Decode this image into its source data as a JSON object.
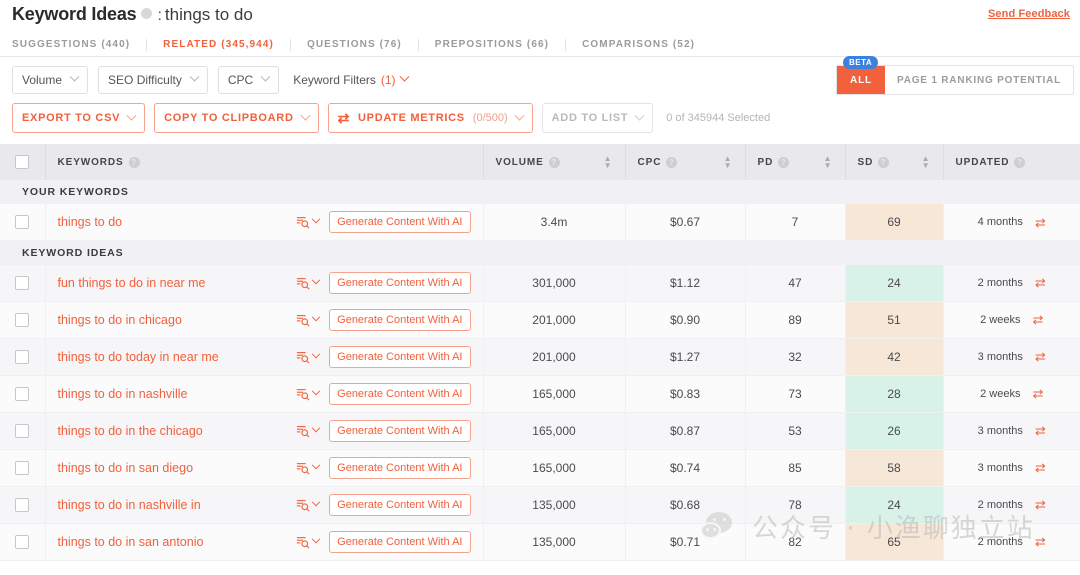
{
  "header": {
    "title": "Keyword Ideas",
    "separator": ":",
    "keyword": "things to do",
    "send_feedback": "Send Feedback",
    "info_icon": "info-icon"
  },
  "tabs": [
    {
      "label": "SUGGESTIONS (440)",
      "active": false
    },
    {
      "label": "RELATED (345,944)",
      "active": true
    },
    {
      "label": "QUESTIONS (76)",
      "active": false
    },
    {
      "label": "PREPOSITIONS (66)",
      "active": false
    },
    {
      "label": "COMPARISONS (52)",
      "active": false
    }
  ],
  "filters": {
    "chips": [
      "Volume",
      "SEO Difficulty",
      "CPC"
    ],
    "keyword_filters_label": "Keyword Filters",
    "keyword_filters_count": "(1)",
    "toggle": {
      "beta_badge": "BETA",
      "all_label": "ALL",
      "page1_label": "PAGE 1 RANKING POTENTIAL"
    }
  },
  "actions": {
    "export_csv": "EXPORT TO CSV",
    "copy_clipboard": "COPY TO CLIPBOARD",
    "update_metrics": "UPDATE METRICS",
    "update_metrics_count": "(0/500)",
    "add_to_list": "ADD TO LIST",
    "selection_status": "0 of 345944 Selected"
  },
  "table": {
    "columns": [
      {
        "label": "KEYWORDS",
        "sortable": false
      },
      {
        "label": "VOLUME",
        "sortable": true
      },
      {
        "label": "CPC",
        "sortable": true
      },
      {
        "label": "PD",
        "sortable": true
      },
      {
        "label": "SD",
        "sortable": true
      },
      {
        "label": "UPDATED",
        "sortable": false
      }
    ],
    "groups": [
      {
        "title": "YOUR KEYWORDS",
        "rows": [
          {
            "keyword": "things to do",
            "generate": "Generate Content With AI",
            "volume": "3.4m",
            "cpc": "$0.67",
            "pd": "7",
            "sd": "69",
            "sd_color": "#f6e7d6",
            "updated": "4 months"
          }
        ]
      },
      {
        "title": "KEYWORD IDEAS",
        "rows": [
          {
            "keyword": "fun things to do in near me",
            "generate": "Generate Content With AI",
            "volume": "301,000",
            "cpc": "$1.12",
            "pd": "47",
            "sd": "24",
            "sd_color": "#d9f2e9",
            "updated": "2 months"
          },
          {
            "keyword": "things to do in chicago",
            "generate": "Generate Content With AI",
            "volume": "201,000",
            "cpc": "$0.90",
            "pd": "89",
            "sd": "51",
            "sd_color": "#f6e7d6",
            "updated": "2 weeks"
          },
          {
            "keyword": "things to do today in near me",
            "generate": "Generate Content With AI",
            "volume": "201,000",
            "cpc": "$1.27",
            "pd": "32",
            "sd": "42",
            "sd_color": "#f6e7d6",
            "updated": "3 months"
          },
          {
            "keyword": "things to do in nashville",
            "generate": "Generate Content With AI",
            "volume": "165,000",
            "cpc": "$0.83",
            "pd": "73",
            "sd": "28",
            "sd_color": "#d9f2e9",
            "updated": "2 weeks"
          },
          {
            "keyword": "things to do in the chicago",
            "generate": "Generate Content With AI",
            "volume": "165,000",
            "cpc": "$0.87",
            "pd": "53",
            "sd": "26",
            "sd_color": "#d9f2e9",
            "updated": "3 months"
          },
          {
            "keyword": "things to do in san diego",
            "generate": "Generate Content With AI",
            "volume": "165,000",
            "cpc": "$0.74",
            "pd": "85",
            "sd": "58",
            "sd_color": "#f6e7d6",
            "updated": "3 months"
          },
          {
            "keyword": "things to do in nashville in",
            "generate": "Generate Content With AI",
            "volume": "135,000",
            "cpc": "$0.68",
            "pd": "78",
            "sd": "24",
            "sd_color": "#d9f2e9",
            "updated": "2 months"
          },
          {
            "keyword": "things to do in san antonio",
            "generate": "Generate Content With AI",
            "volume": "135,000",
            "cpc": "$0.71",
            "pd": "82",
            "sd": "65",
            "sd_color": "#f6e7d6",
            "updated": "2 months"
          }
        ]
      }
    ]
  },
  "watermark": {
    "text": "公众号 · 小渔聊独立站"
  },
  "colors": {
    "accent": "#f2603c",
    "beta": "#3b82e0",
    "sd_hard": "#f6e7d6",
    "sd_easy": "#d9f2e9"
  }
}
